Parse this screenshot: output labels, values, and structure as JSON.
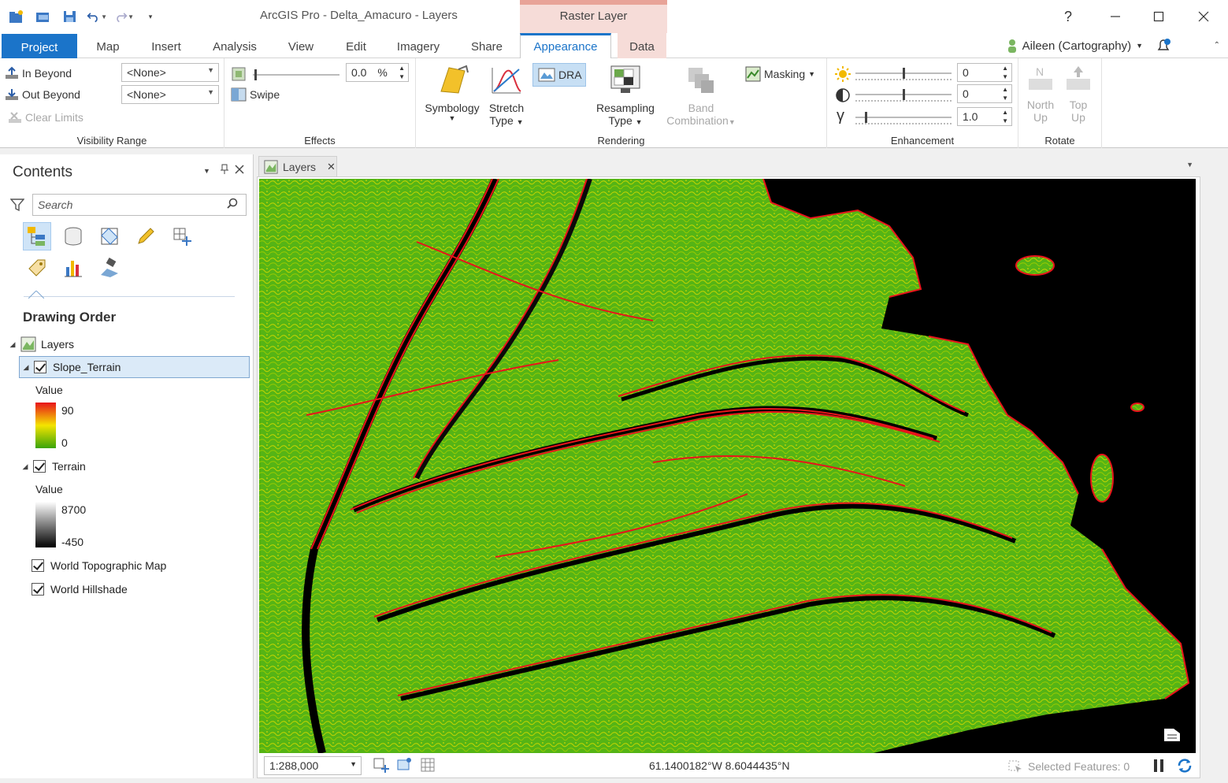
{
  "app": {
    "title": "ArcGIS Pro - Delta_Amacuro - Layers",
    "context_tab_group": "Raster Layer",
    "help": "?",
    "user": "Aileen (Cartography)"
  },
  "tabs": [
    {
      "label": "Project"
    },
    {
      "label": "Map"
    },
    {
      "label": "Insert"
    },
    {
      "label": "Analysis"
    },
    {
      "label": "View"
    },
    {
      "label": "Edit"
    },
    {
      "label": "Imagery"
    },
    {
      "label": "Share"
    },
    {
      "label": "Appearance"
    },
    {
      "label": "Data"
    }
  ],
  "ribbon": {
    "visibility": {
      "in_beyond": "In Beyond",
      "out_beyond": "Out Beyond",
      "clear_limits": "Clear Limits",
      "in_value": "<None>",
      "out_value": "<None>",
      "label": "Visibility Range"
    },
    "effects": {
      "transparency_value": "0.0",
      "percent": "%",
      "swipe": "Swipe",
      "label": "Effects"
    },
    "rendering": {
      "symbology": "Symbology",
      "stretch": "Stretch",
      "stretch_type": "Type",
      "dra": "DRA",
      "resampling": "Resampling",
      "resampling_type": "Type",
      "band": "Band",
      "band_combination": "Combination",
      "masking": "Masking",
      "label": "Rendering"
    },
    "enhancement": {
      "brightness": "0",
      "contrast": "0",
      "gamma": "1.0",
      "gamma_symbol": "γ",
      "label": "Enhancement"
    },
    "rotate": {
      "north": "North",
      "north_up": "Up",
      "top": "Top",
      "top_up": "Up",
      "label": "Rotate"
    }
  },
  "contents": {
    "title": "Contents",
    "search_placeholder": "Search",
    "drawing_order": "Drawing Order",
    "root": "Layers",
    "layers": [
      {
        "name": "Slope_Terrain",
        "legend_title": "Value",
        "max": "90",
        "min": "0"
      },
      {
        "name": "Terrain",
        "legend_title": "Value",
        "max": "8700",
        "min": "-450"
      },
      {
        "name": "World Topographic Map"
      },
      {
        "name": "World Hillshade"
      }
    ]
  },
  "map": {
    "tab_label": "Layers",
    "scale": "1:288,000",
    "coordinates": "61.1400182°W 8.6044435°N",
    "selected_features": "Selected Features: 0"
  },
  "colors": {
    "accent": "#1b74c9",
    "context_tab": "#f6dcd8",
    "slope_high": "#e8141b",
    "slope_mid": "#f4e400",
    "slope_low": "#3aa40a"
  }
}
